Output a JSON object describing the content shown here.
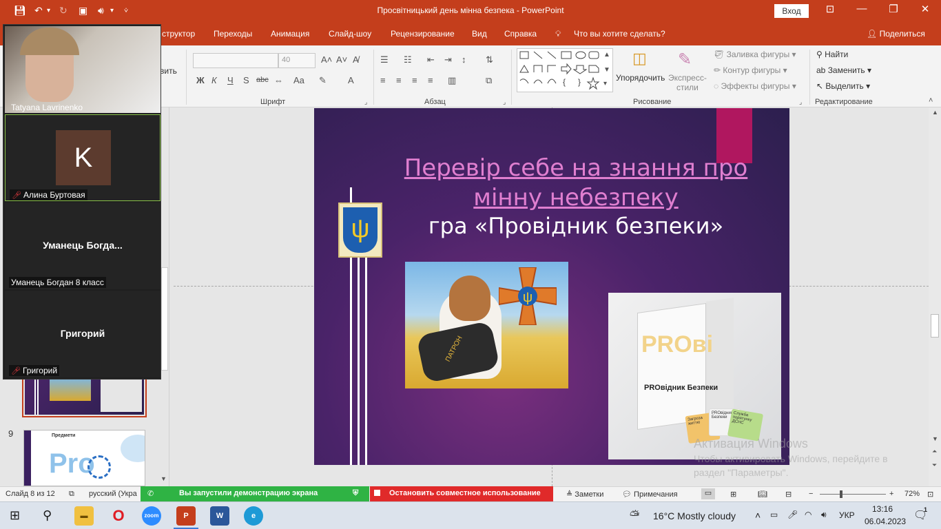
{
  "titlebar": {
    "title": "Просвітницький день мінна безпека  -  PowerPoint",
    "signin": "Вход"
  },
  "tabs": [
    {
      "label": "структор"
    },
    {
      "label": "Переходы"
    },
    {
      "label": "Анимация"
    },
    {
      "label": "Слайд-шоу"
    },
    {
      "label": "Рецензирование"
    },
    {
      "label": "Вид"
    },
    {
      "label": "Справка"
    },
    {
      "label": "Что вы хотите сделать?"
    }
  ],
  "share_label": "Поделиться",
  "ribbon": {
    "partial_label": "вить",
    "font_size": "40",
    "font_group": "Шрифт",
    "paragraph_group": "Абзац",
    "drawing_group": "Рисование",
    "editing_group": "Редактирование",
    "arrange": "Упорядочить",
    "quick_styles": "Экспресс-\nстили",
    "shape_fill": "Заливка фигуры",
    "shape_outline": "Контур фигуры",
    "shape_effects": "Эффекты фигуры",
    "find": "Найти",
    "replace": "Заменить",
    "select": "Выделить",
    "bold": "Ж",
    "italic": "К",
    "underline": "Ч",
    "shadow": "S",
    "strike": "abc",
    "case": "Aa"
  },
  "slide": {
    "title": "Перевір себе на знання про мінну небезпеку",
    "subtitle": "гра «Провідник безпеки»",
    "dog_vest_label": "ПАТРОН",
    "box_brand": "PROві",
    "box_title": "PROвідник Безпеки",
    "cards": [
      "Загроза життю",
      "PROвідник Безпеки",
      "Служба порятунку ДСНС"
    ]
  },
  "thumbnails": {
    "next_slide_number": "9",
    "next_slide_caption": "Предмети",
    "next_slide_brand": "Pro"
  },
  "zoom": {
    "participants": [
      {
        "name": "Tatyana Lavrinenko",
        "avatar_letter": "",
        "center_name": ""
      },
      {
        "name": "Алина Буртовая",
        "avatar_letter": "K",
        "center_name": ""
      },
      {
        "name": "Уманець Богдан 8 класс",
        "avatar_letter": "",
        "center_name": "Уманець  Богда..."
      },
      {
        "name": "Григорий",
        "avatar_letter": "",
        "center_name": "Григорий"
      }
    ]
  },
  "statusbar": {
    "slide_counter": "Слайд 8 из 12",
    "language": "русский (Укра",
    "share_notice": "Вы запустили демонстрацию экрана",
    "stop_share": "Остановить совместное использование",
    "notes": "Заметки",
    "comments": "Примечания",
    "zoom_level": "72%"
  },
  "watermark": {
    "title": "Активация Windows",
    "line1": "Чтобы активировать Windows, перейдите в",
    "line2": "раздел \"Параметры\"."
  },
  "taskbar": {
    "weather": "16°C  Mostly cloudy",
    "language": "УКР",
    "time": "13:16",
    "date": "06.04.2023",
    "notifications": "1"
  }
}
